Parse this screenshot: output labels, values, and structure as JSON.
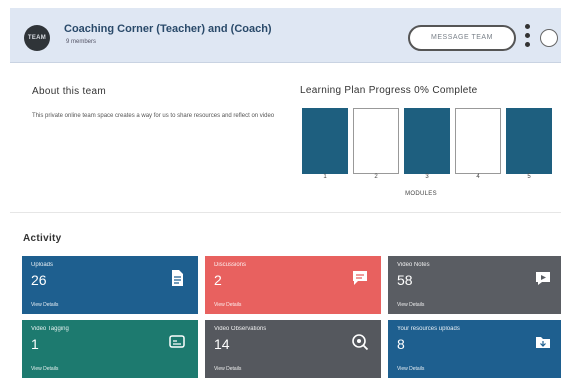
{
  "header": {
    "avatar_text": "TEAM",
    "team_name": "Coaching Corner (Teacher) and (Coach)",
    "member_count": "9 members",
    "message_button": "MESSAGE TEAM"
  },
  "about": {
    "title": "About this team",
    "description": "This private online team space creates a way for us to share resources and reflect on video"
  },
  "learning_plan": {
    "title": "Learning Plan Progress 0% Complete",
    "progress_percent": 0,
    "modules": [
      {
        "number": "1",
        "filled": true
      },
      {
        "number": "2",
        "filled": false
      },
      {
        "number": "3",
        "filled": true
      },
      {
        "number": "4",
        "filled": false
      },
      {
        "number": "5",
        "filled": true
      }
    ],
    "modules_label": "MODULES"
  },
  "activity": {
    "title": "Activity",
    "cards": [
      {
        "label": "Uploads",
        "value": "26",
        "link": "View Details",
        "color": "#1e5f8f",
        "icon": "document-icon"
      },
      {
        "label": "Discussions",
        "value": "2",
        "link": "View Details",
        "color": "#e8615f",
        "icon": "chat-icon"
      },
      {
        "label": "Video Notes",
        "value": "58",
        "link": "View Details",
        "color": "#5a5d63",
        "icon": "video-comment-icon"
      },
      {
        "label": "Video Tagging",
        "value": "1",
        "link": "View Details",
        "color": "#1d7a6f",
        "icon": "video-tag-icon"
      },
      {
        "label": "Video Observations",
        "value": "14",
        "link": "View Details",
        "color": "#55585e",
        "icon": "zoom-icon"
      },
      {
        "label": "Your resources uploads",
        "value": "8",
        "link": "View Details",
        "color": "#1e5f8f",
        "icon": "folder-icon"
      }
    ]
  }
}
